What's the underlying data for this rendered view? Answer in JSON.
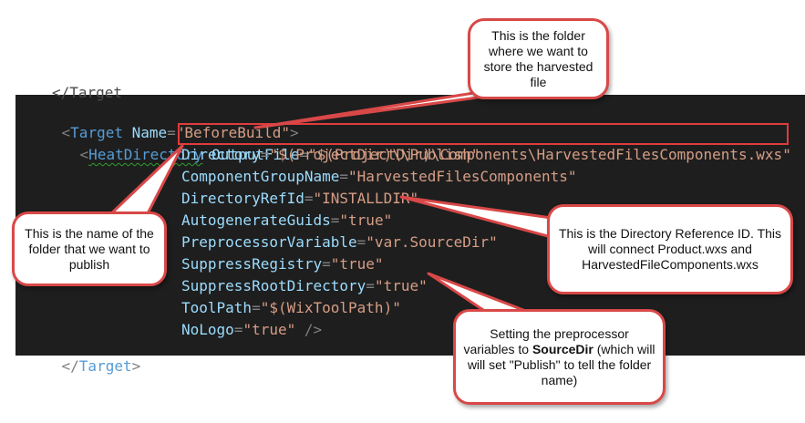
{
  "code": {
    "top_fragment": "</Target",
    "line1": {
      "open": "<",
      "tag": "Target",
      "attr": "Name",
      "eq": "=",
      "value": "\"BeforeBuild\"",
      "close": ">"
    },
    "line2": {
      "open": "<",
      "tag": "HeatDirectory",
      "attr": "OutputFile",
      "eq": "=",
      "value": "\"$(ProjectDir)\\Components\\HarvestedFilesComponents.wxs\""
    },
    "attrs": [
      {
        "name": "Directory",
        "value": "\"$(ProjectDir)\\\\Publish\""
      },
      {
        "name": "ComponentGroupName",
        "value": "\"HarvestedFilesComponents\""
      },
      {
        "name": "DirectoryRefId",
        "value": "\"INSTALLDIR\""
      },
      {
        "name": "AutogenerateGuids",
        "value": "\"true\""
      },
      {
        "name": "PreprocessorVariable",
        "value": "\"var.SourceDir\""
      },
      {
        "name": "SuppressRegistry",
        "value": "\"true\""
      },
      {
        "name": "SuppressRootDirectory",
        "value": "\"true\""
      },
      {
        "name": "ToolPath",
        "value": "\"$(WixToolPath)\""
      },
      {
        "name": "NoLogo",
        "value": "\"true\"",
        "tail": " />"
      }
    ],
    "closing": {
      "open": "</",
      "tag": "Target",
      "close": ">"
    }
  },
  "callouts": {
    "output_folder": "This is the folder where we want to store the harvested file",
    "publish_folder": "This is the name of the folder that we want to publish",
    "directory_ref": "This is the Directory Reference ID. This will connect Product.wxs and HarvestedFileComponents.wxs",
    "preproc": {
      "before": "Setting the preprocessor variables to ",
      "bold": "SourceDir",
      "after": " (which will will set \"Publish\" to tell the folder name)"
    }
  },
  "colors": {
    "editor_bg": "#1e1e1e",
    "tag": "#569cd6",
    "attribute": "#9cdcfe",
    "string": "#d69d85",
    "punctuation": "#808080",
    "annotation": "#d94848"
  }
}
